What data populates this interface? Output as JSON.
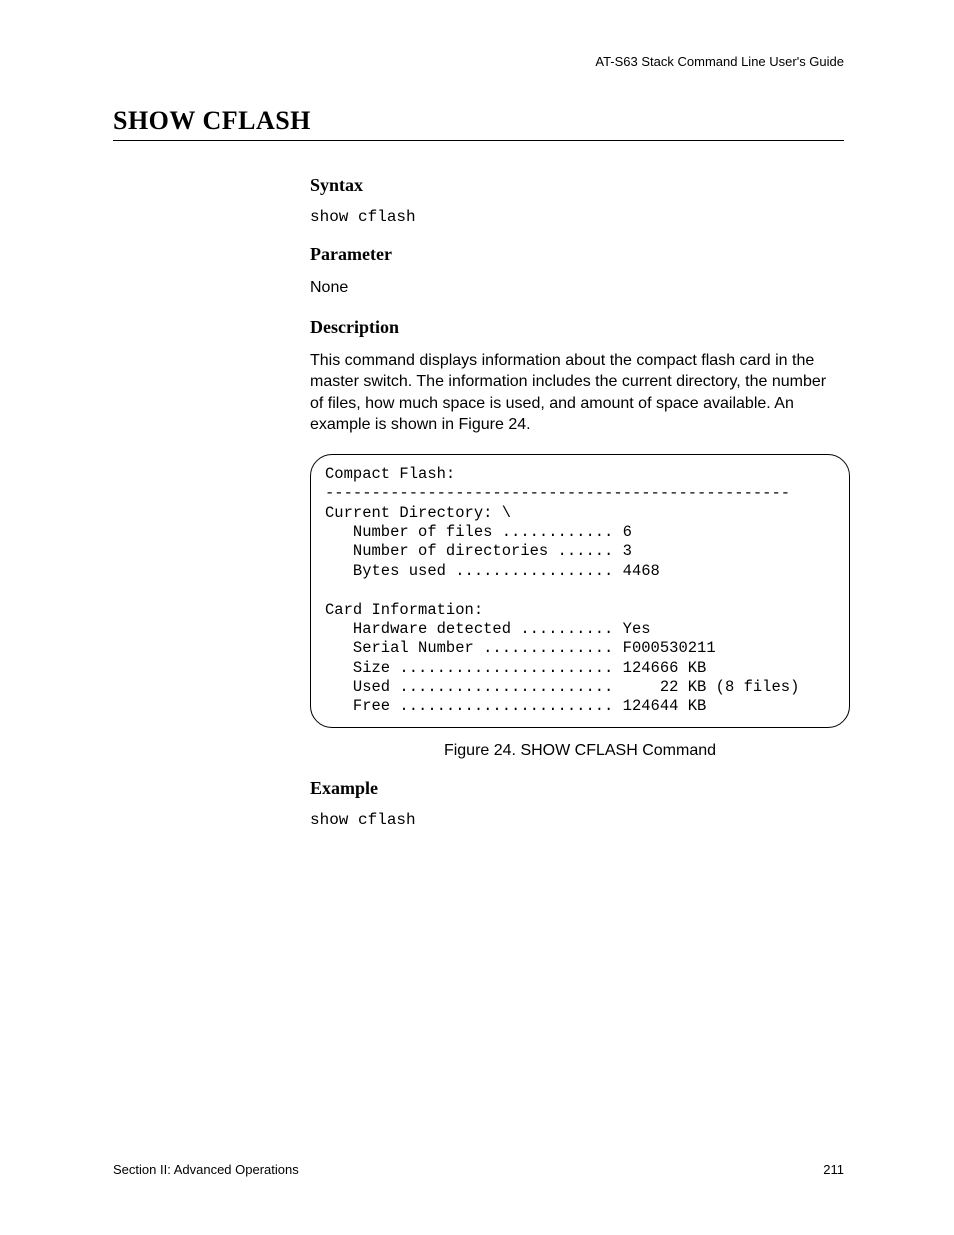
{
  "header": {
    "guide": "AT-S63 Stack Command Line User's Guide"
  },
  "title": "SHOW CFLASH",
  "sections": {
    "syntax": {
      "heading": "Syntax",
      "command": "show cflash"
    },
    "parameter": {
      "heading": "Parameter",
      "value": "None"
    },
    "description": {
      "heading": "Description",
      "text": "This command displays information about the compact flash card in the master switch. The information includes the current directory, the number of files, how much space is used, and amount of space available. An example is shown in Figure 24."
    },
    "codeblock": "Compact Flash:\n--------------------------------------------------\nCurrent Directory: \\\n   Number of files ............ 6\n   Number of directories ...... 3\n   Bytes used ................. 4468\n\nCard Information:\n   Hardware detected .......... Yes\n   Serial Number .............. F000530211\n   Size ....................... 124666 KB\n   Used .......................     22 KB (8 files)\n   Free ....................... 124644 KB",
    "figure_caption": "Figure 24. SHOW CFLASH Command",
    "example": {
      "heading": "Example",
      "command": "show cflash"
    }
  },
  "footer": {
    "section": "Section II: Advanced Operations",
    "page": "211"
  }
}
